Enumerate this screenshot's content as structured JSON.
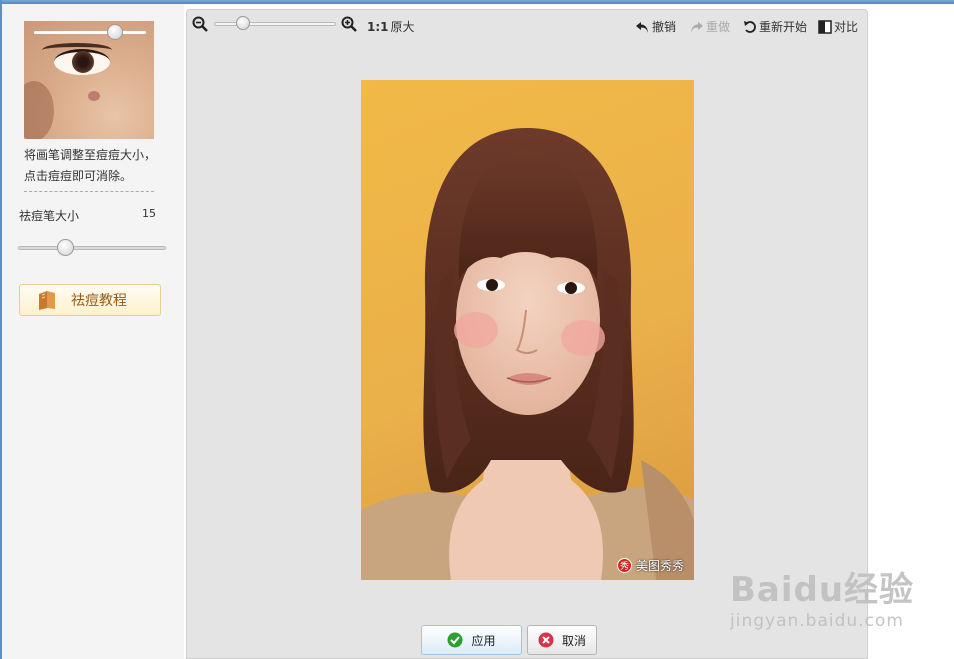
{
  "panel": {
    "hint_line1": "将画笔调整至痘痘大小，",
    "hint_line2": "点击痘痘即可消除。",
    "brush_size_label": "祛痘笔大小",
    "brush_size_value": "15",
    "tutorial_label": "祛痘教程"
  },
  "toolbar": {
    "ratio_bold": "1:1",
    "ratio_text": "原大",
    "undo": "撤销",
    "redo": "重做",
    "restart": "重新开始",
    "compare": "对比"
  },
  "photo": {
    "watermark_logo": "秀",
    "watermark_text": "美图秀秀"
  },
  "actions": {
    "apply": "应用",
    "cancel": "取消"
  },
  "site_watermark": {
    "brand": "Baidu经验",
    "url": "jingyan.baidu.com"
  },
  "colors": {
    "accent_blue": "#5b8fcc",
    "photo_background": "#f1b947",
    "hair": "#5a2f22",
    "apply_green": "#2ea02e",
    "cancel_red": "#d6334a"
  }
}
